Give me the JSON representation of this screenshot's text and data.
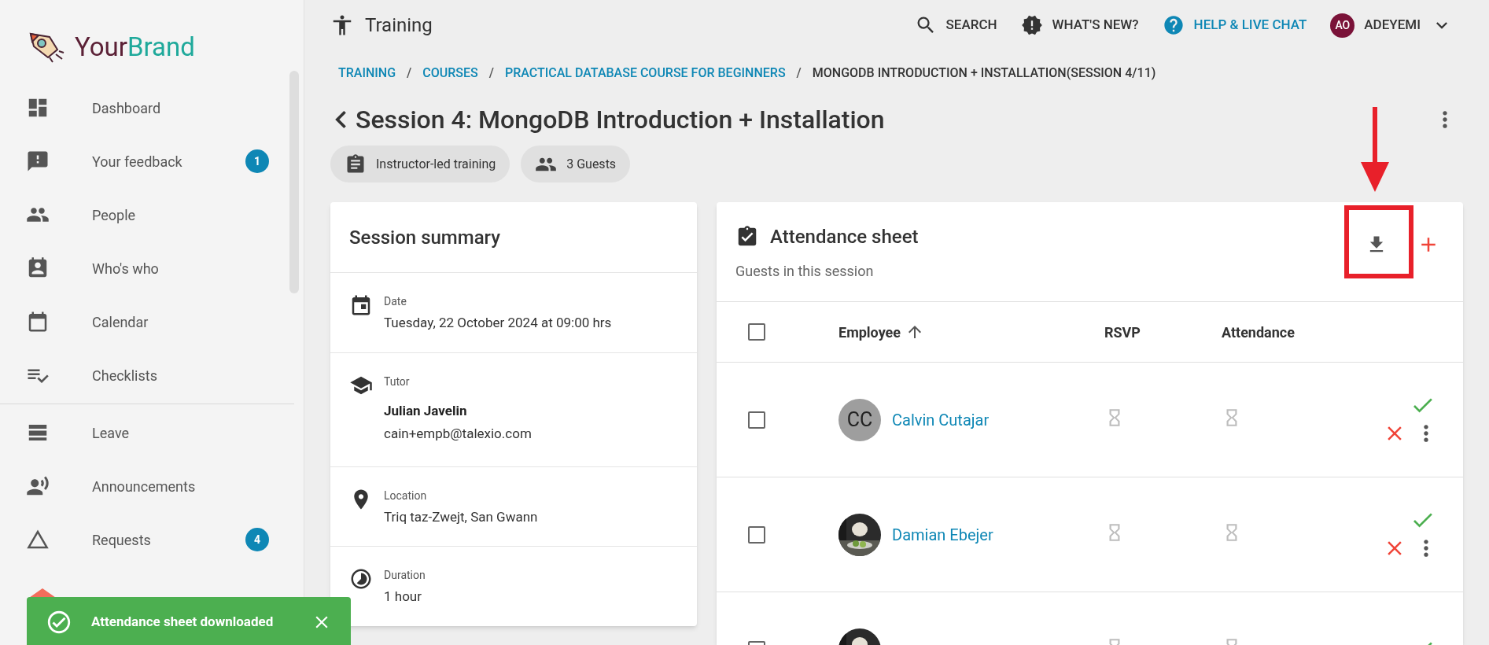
{
  "brand": {
    "name_part_1": "Your",
    "name_part_2": "Brand"
  },
  "sidebar": {
    "items": [
      {
        "label": "Dashboard"
      },
      {
        "label": "Your feedback",
        "badge": "1"
      },
      {
        "label": "People"
      },
      {
        "label": "Who's who"
      },
      {
        "label": "Calendar"
      },
      {
        "label": "Checklists",
        "divider_after": true
      },
      {
        "label": "Leave"
      },
      {
        "label": "Announcements"
      },
      {
        "label": "Requests",
        "badge": "4"
      }
    ]
  },
  "header": {
    "title": "Training",
    "actions": [
      {
        "kind": "search",
        "label": "SEARCH"
      },
      {
        "kind": "news",
        "label": "WHAT'S NEW?"
      },
      {
        "kind": "help",
        "label": "HELP & LIVE CHAT"
      }
    ],
    "user": {
      "initials": "AO",
      "name": "ADEYEMI"
    }
  },
  "breadcrumb": [
    {
      "label": "TRAINING",
      "link": true
    },
    {
      "separator_before": "/",
      "label": "COURSES",
      "link": true
    },
    {
      "separator_before": "/",
      "label": "PRACTICAL DATABASE COURSE FOR BEGINNERS",
      "link": true
    },
    {
      "separator_before": "/",
      "label": "MONGODB INTRODUCTION + INSTALLATION(SESSION 4/11)",
      "link": false
    }
  ],
  "page_title": "Session 4: MongoDB Introduction + Installation",
  "chips": [
    {
      "kind": "type",
      "label": "Instructor-led training"
    },
    {
      "kind": "guests",
      "label": "3 Guests"
    }
  ],
  "summary": {
    "title": "Session summary",
    "sections": [
      {
        "kind": "date",
        "label": "Date",
        "value": "Tuesday, 22 October 2024 at 09:00 hrs"
      },
      {
        "kind": "tutor",
        "label": "Tutor",
        "name": "Julian Javelin",
        "value": "cain+empb@talexio.com"
      },
      {
        "kind": "location",
        "label": "Location",
        "value": "Triq taz-Zwejt, San Gwann"
      },
      {
        "kind": "duration",
        "label": "Duration",
        "value": "1 hour"
      }
    ]
  },
  "attendance": {
    "title": "Attendance sheet",
    "subtitle": "Guests in this session",
    "select_all": {
      "checked": false
    },
    "columns": [
      "Employee",
      "RSVP",
      "Attendance"
    ],
    "rows": [
      {
        "checked": false,
        "avatar": {
          "kind": "initials",
          "text": "CC"
        },
        "name": "Calvin Cutajar"
      },
      {
        "checked": false,
        "name": "Damian Ebejer"
      },
      {
        "checked": false
      }
    ]
  },
  "toast": {
    "message": "Attendance sheet downloaded"
  }
}
